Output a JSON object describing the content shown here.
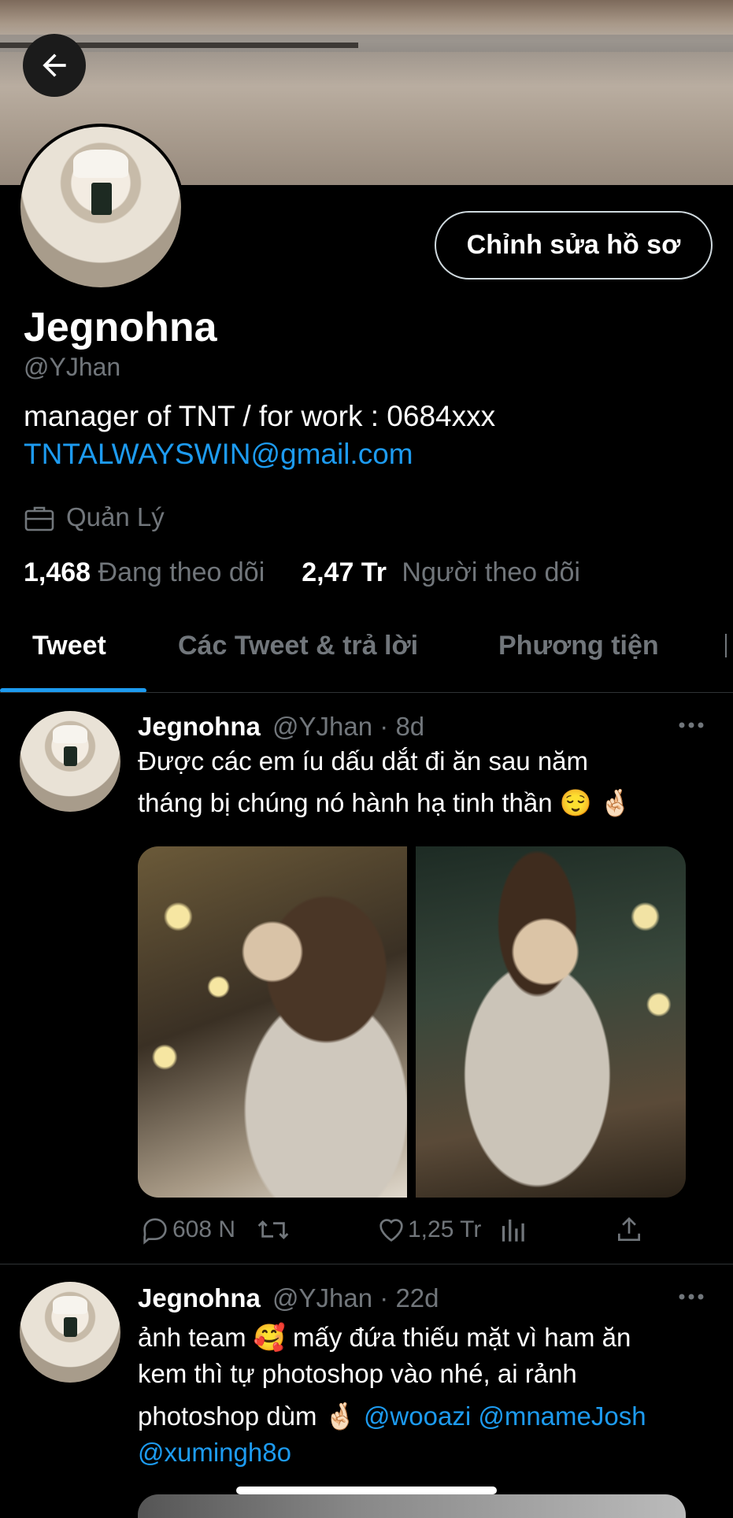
{
  "profile": {
    "display_name": "Jegnohna",
    "handle": "@YJhan",
    "bio_line1": "manager of TNT / for work : 0684xxx",
    "bio_email": "TNTALWAYSWIN@gmail.com",
    "work_label": "Quản Lý",
    "edit_button_label": "Chỉnh sửa hồ sơ",
    "following_count": "1,468",
    "following_label": "Đang theo dõi",
    "followers_count": "2,47 Tr",
    "followers_label": "Người theo dõi"
  },
  "tabs": [
    {
      "label": "Tweet",
      "active": true
    },
    {
      "label": "Các Tweet & trả lời",
      "active": false
    },
    {
      "label": "Phương tiện",
      "active": false
    }
  ],
  "tweets": [
    {
      "name": "Jegnohna",
      "handle": "@YJhan",
      "separator": "·",
      "time": "8d",
      "line1": "Được các em íu dấu dắt đi ăn sau năm",
      "line2": "tháng bị chúng nó hành hạ tinh thần 😌 🤞🏻",
      "replies": "608 N",
      "likes": "1,25 Tr"
    },
    {
      "name": "Jegnohna",
      "handle": "@YJhan",
      "separator": "·",
      "time": "22d",
      "line1": "ảnh team 🥰  mấy đứa thiếu mặt vì ham ăn",
      "line2": "kem thì tự photoshop vào nhé, ai rảnh",
      "line3": "photoshop dùm 🤞🏻",
      "mentions": "@wooazi @mnameJosh",
      "line4": "@xumingh8o"
    }
  ],
  "icons": {
    "back": "arrow-left-icon",
    "work": "briefcase-icon",
    "reply": "comment-icon",
    "retweet": "retweet-icon",
    "like": "heart-icon",
    "views": "analytics-icon",
    "share": "share-icon",
    "more": "more-icon"
  },
  "colors": {
    "accent": "#1d9bf0",
    "secondary_text": "#71767b",
    "background": "#000000"
  }
}
